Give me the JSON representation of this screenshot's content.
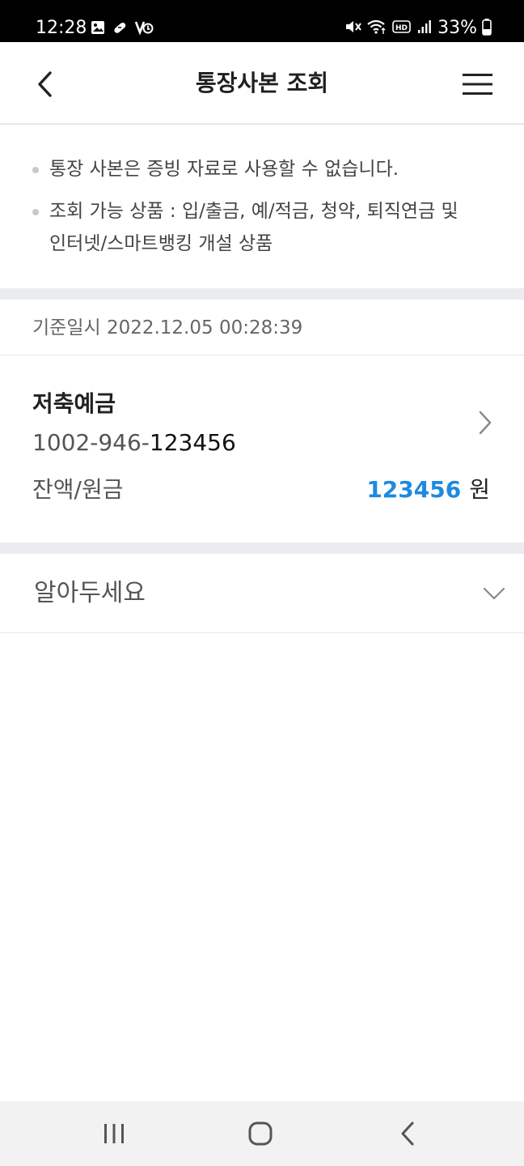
{
  "status_bar": {
    "time": "12:28",
    "battery": "33%",
    "left_icons": [
      "gallery-icon",
      "bandage-icon",
      "vpn-icon"
    ],
    "right_icons": [
      "mute-icon",
      "wifi-icon",
      "hd-icon",
      "signal-icon",
      "battery-icon"
    ]
  },
  "header": {
    "title": "통장사본 조회",
    "back_icon": "chevron-left-icon",
    "menu_icon": "hamburger-menu-icon"
  },
  "notice": {
    "items": [
      "통장 사본은 증빙 자료로 사용할 수 없습니다.",
      "조회 가능 상품 : 입/출금, 예/적금, 청약, 퇴직연금 및",
      "인터넷/스마트뱅킹 개설 상품"
    ]
  },
  "timestamp": {
    "label": "기준일시 2022.12.05 00:28:39"
  },
  "account": {
    "name": "저축예금",
    "number_prefix": "1002-946-",
    "number_suffix": "123456",
    "balance_label": "잔액/원금",
    "balance_amount": "123456",
    "balance_unit": "원",
    "amount_color": "#1d8ae0"
  },
  "info": {
    "title": "알아두세요"
  },
  "nav": {
    "icons": [
      "recent-apps-icon",
      "home-icon",
      "back-icon"
    ]
  }
}
